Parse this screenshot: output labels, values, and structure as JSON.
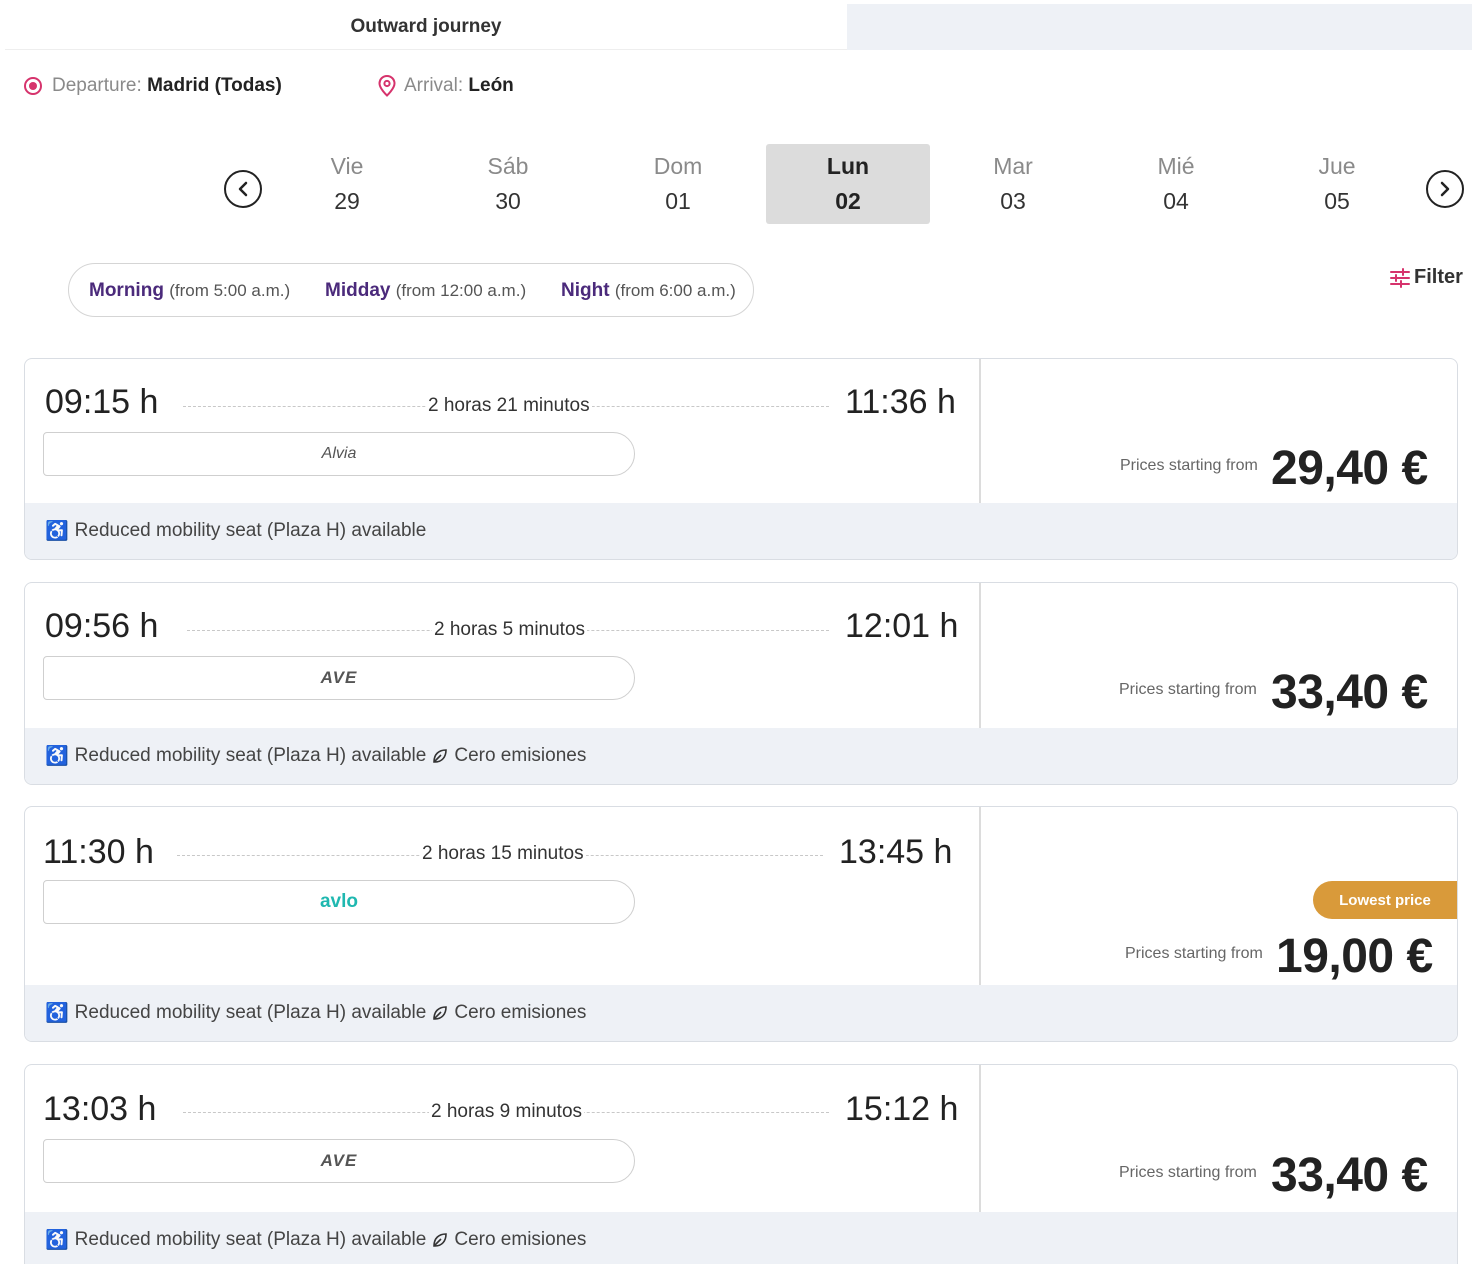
{
  "tabs": {
    "outward": "Outward journey"
  },
  "route": {
    "departure_label": "Departure:",
    "departure_value": "Madrid (Todas)",
    "arrival_label": "Arrival:",
    "arrival_value": "León"
  },
  "dates": [
    {
      "day": "Vie",
      "num": "29",
      "selected": false
    },
    {
      "day": "Sáb",
      "num": "30",
      "selected": false
    },
    {
      "day": "Dom",
      "num": "01",
      "selected": false
    },
    {
      "day": "Lun",
      "num": "02",
      "selected": true
    },
    {
      "day": "Mar",
      "num": "03",
      "selected": false
    },
    {
      "day": "Mié",
      "num": "04",
      "selected": false
    },
    {
      "day": "Jue",
      "num": "05",
      "selected": false
    }
  ],
  "time_filters": [
    {
      "name": "Morning",
      "range": "(from 5:00 a.m.)"
    },
    {
      "name": "Midday",
      "range": "(from 12:00 a.m.)"
    },
    {
      "name": "Night",
      "range": "(from 6:00 a.m.)"
    }
  ],
  "filter_label": "Filter",
  "price_label": "Prices starting from",
  "features": {
    "reduced_mobility": "Reduced mobility seat (Plaza H) available",
    "zero_emissions": "Cero emisiones"
  },
  "lowest_price_badge": "Lowest price",
  "trips": [
    {
      "depart": "09:15 h",
      "arrive": "11:36 h",
      "duration": "2 horas 21 minutos",
      "brand": "Alvia",
      "price": "29,40 €",
      "zero_emissions": false,
      "lowest": false
    },
    {
      "depart": "09:56 h",
      "arrive": "12:01 h",
      "duration": "2 horas 5 minutos",
      "brand": "AVE",
      "price": "33,40 €",
      "zero_emissions": true,
      "lowest": false
    },
    {
      "depart": "11:30 h",
      "arrive": "13:45 h",
      "duration": "2 horas 15 minutos",
      "brand": "avlo",
      "price": "19,00 €",
      "zero_emissions": true,
      "lowest": true
    },
    {
      "depart": "13:03 h",
      "arrive": "15:12 h",
      "duration": "2 horas 9 minutos",
      "brand": "AVE",
      "price": "33,40 €",
      "zero_emissions": true,
      "lowest": false
    }
  ],
  "colors": {
    "accent": "#d6336c",
    "purple": "#4b2a7b",
    "badge": "#d99a3a",
    "avlo": "#1fb8b0"
  }
}
